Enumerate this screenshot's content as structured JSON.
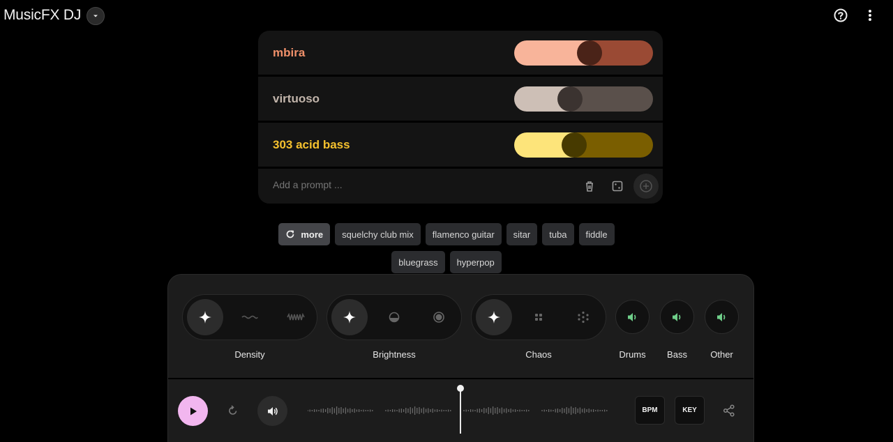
{
  "header": {
    "title": "MusicFX DJ",
    "help_icon": "help-circle-icon",
    "menu_icon": "more-vert-icon"
  },
  "prompts": [
    {
      "label": "mbira",
      "weight": 0.55,
      "color": "#f0906a",
      "fill": "#f8b49a",
      "rest": "#9a4a34",
      "thumb": "#4a2318"
    },
    {
      "label": "virtuoso",
      "weight": 0.38,
      "color": "#c2b5ab",
      "fill": "#cdbfb6",
      "rest": "#5a504b",
      "thumb": "#3b3330"
    },
    {
      "label": "303 acid bass",
      "weight": 0.42,
      "color": "#f5c12e",
      "fill": "#fde47a",
      "rest": "#7a5e00",
      "thumb": "#473a00"
    }
  ],
  "add_prompt": {
    "placeholder": "Add a prompt ...",
    "delete_icon": "trash-icon",
    "random_icon": "dice-icon",
    "submit_icon": "plus-circle-icon"
  },
  "chips": {
    "more_label": "more",
    "row1": [
      "squelchy club mix",
      "flamenco guitar",
      "sitar",
      "tuba",
      "fiddle"
    ],
    "row2": [
      "bluegrass",
      "hyperpop"
    ]
  },
  "controls": {
    "density_label": "Density",
    "brightness_label": "Brightness",
    "chaos_label": "Chaos",
    "stems": [
      {
        "label": "Drums",
        "icon": "volume-icon"
      },
      {
        "label": "Bass",
        "icon": "volume-icon"
      },
      {
        "label": "Other",
        "icon": "volume-icon"
      }
    ],
    "stem_color": "#6fcf8a"
  },
  "transport": {
    "bpm_label": "BPM",
    "key_label": "KEY",
    "play_color": "#f2b6ef"
  }
}
